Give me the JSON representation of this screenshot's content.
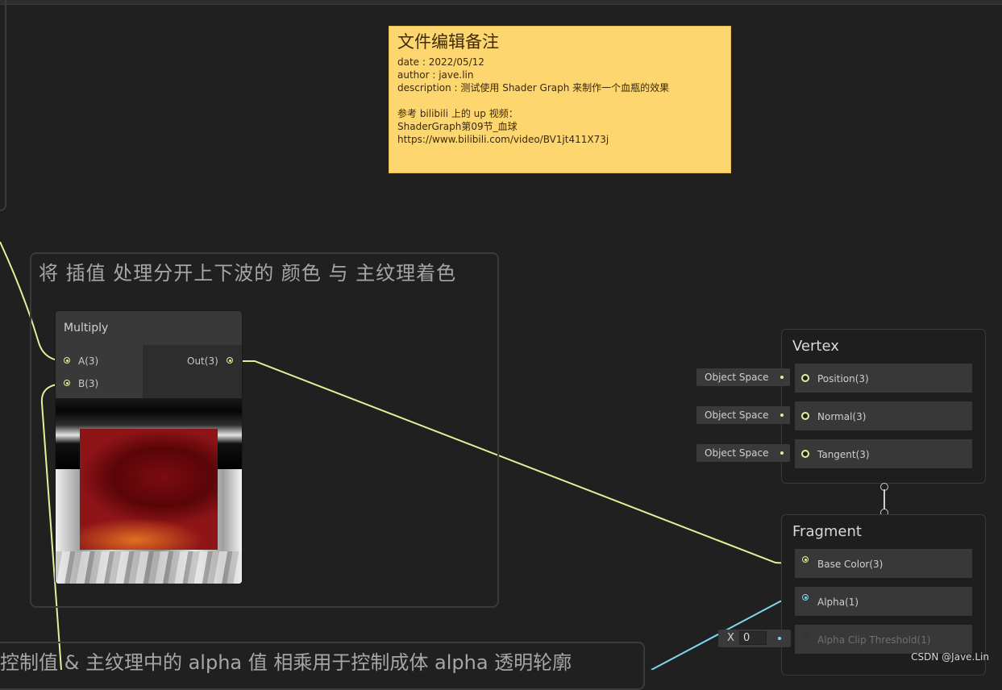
{
  "sticky_note": {
    "title": "文件编辑备注",
    "body": "date : 2022/05/12\nauthor : jave.lin\ndescription : 测试使用 Shader Graph 来制作一个血瓶的效果\n\n参考 bilibili 上的 up 视频：\nShaderGraph第09节_血球\nhttps://www.bilibili.com/video/BV1jt411X73j"
  },
  "group_main": {
    "title": "将 插值 处理分开上下波的 颜色 与 主纹理着色"
  },
  "group_bottom": {
    "title": "控制值 & 主纹理中的 alpha 值 相乘用于控制成体 alpha 透明轮廓"
  },
  "multiply_node": {
    "title": "Multiply",
    "inputs": [
      "A(3)",
      "B(3)"
    ],
    "output": "Out(3)"
  },
  "vertex": {
    "title": "Vertex",
    "blocks": [
      "Position(3)",
      "Normal(3)",
      "Tangent(3)"
    ],
    "spaces": [
      "Object Space",
      "Object Space",
      "Object Space"
    ]
  },
  "fragment": {
    "title": "Fragment",
    "blocks": [
      "Base Color(3)",
      "Alpha(1)",
      "Alpha Clip Threshold(1)"
    ],
    "clip_input": {
      "label": "X",
      "value": "0"
    }
  },
  "watermark": "CSDN @Jave.Lin",
  "colors": {
    "background": "#202020",
    "sticky": "#fdd66f",
    "vector3_port": "#e6ee9a",
    "float_port": "#7fd6ec"
  }
}
